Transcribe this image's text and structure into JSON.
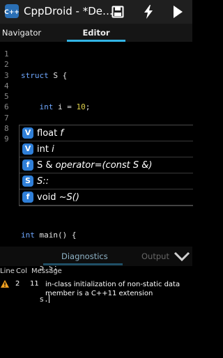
{
  "app": {
    "title": "CppDroid - *De…"
  },
  "tabs": [
    {
      "label": "Navigator",
      "active": false
    },
    {
      "label": "Editor",
      "active": true
    }
  ],
  "editor": {
    "line_numbers": [
      "1",
      "2",
      "3",
      "4",
      "5",
      "6",
      "7",
      "8",
      "9"
    ]
  },
  "autocomplete": {
    "items": [
      {
        "badge": "V",
        "type": "float",
        "name": "f"
      },
      {
        "badge": "V",
        "type": "int",
        "name": "i"
      },
      {
        "badge": "f",
        "type": "S &",
        "name": "operator=(const S &)"
      },
      {
        "badge": "S",
        "type": "",
        "name": "S::"
      },
      {
        "badge": "f",
        "type": "void",
        "name": "~S()"
      }
    ]
  },
  "diagnostics": {
    "tabs": [
      {
        "label": "Diagnostics",
        "active": true
      },
      {
        "label": "Output",
        "active": false
      }
    ],
    "columns": {
      "line": "Line",
      "col": "Col",
      "message": "Message"
    },
    "rows": [
      {
        "line": "2",
        "col": "11",
        "message_1": "in-class initialization of non-static data",
        "message_2": "member is a C++11 extension"
      }
    ]
  },
  "colors": {
    "accent": "#33b5e5",
    "badge": "#2f7fd8",
    "keyword": "#6fa8ff",
    "number": "#e0d24a",
    "warning": "#f0a020"
  }
}
